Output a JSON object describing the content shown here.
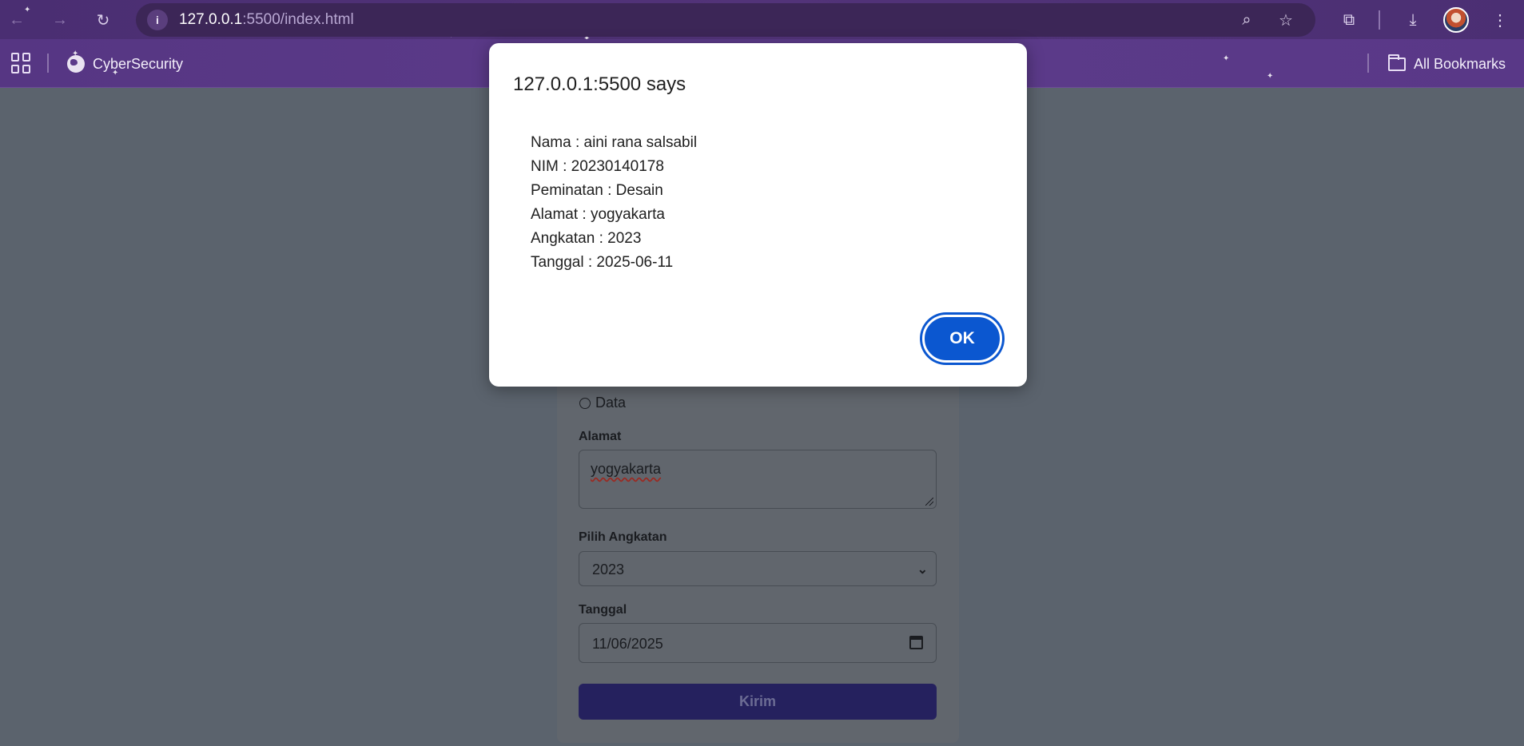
{
  "browser": {
    "url_host": "127.0.0.1",
    "url_path": ":5500/index.html",
    "icons": {
      "back": "arrow-left-icon",
      "forward": "arrow-right-icon",
      "reload": "reload-icon",
      "site_info": "info-icon",
      "zoom": "zoom-icon",
      "bookmark": "star-icon",
      "extensions": "puzzle-icon",
      "downloads": "download-icon",
      "menu": "kebab-menu-icon"
    }
  },
  "bookmarks_bar": {
    "items": [
      {
        "label": "CyberSecurity",
        "icon": "globe-icon"
      }
    ],
    "all_bookmarks_label": "All Bookmarks"
  },
  "form": {
    "radio_option_label": "Data",
    "alamat_label": "Alamat",
    "alamat_value": "yogyakarta",
    "angkatan_label": "Pilih Angkatan",
    "angkatan_value": "2023",
    "tanggal_label": "Tanggal",
    "tanggal_value": "11/06/2025",
    "submit_label": "Kirim"
  },
  "dialog": {
    "title": "127.0.0.1:5500 says",
    "lines": [
      "Nama : aini rana salsabil",
      "NIM : 20230140178",
      "Peminatan : Desain",
      "Alamat : yogyakarta",
      "Angkatan : 2023",
      "Tanggal : 2025-06-11"
    ],
    "ok_label": "OK"
  },
  "colors": {
    "chrome_purple": "#4a2e72",
    "overlay": "#5b636d",
    "ok_button": "#0b57d0",
    "submit_button": "#25215e"
  }
}
